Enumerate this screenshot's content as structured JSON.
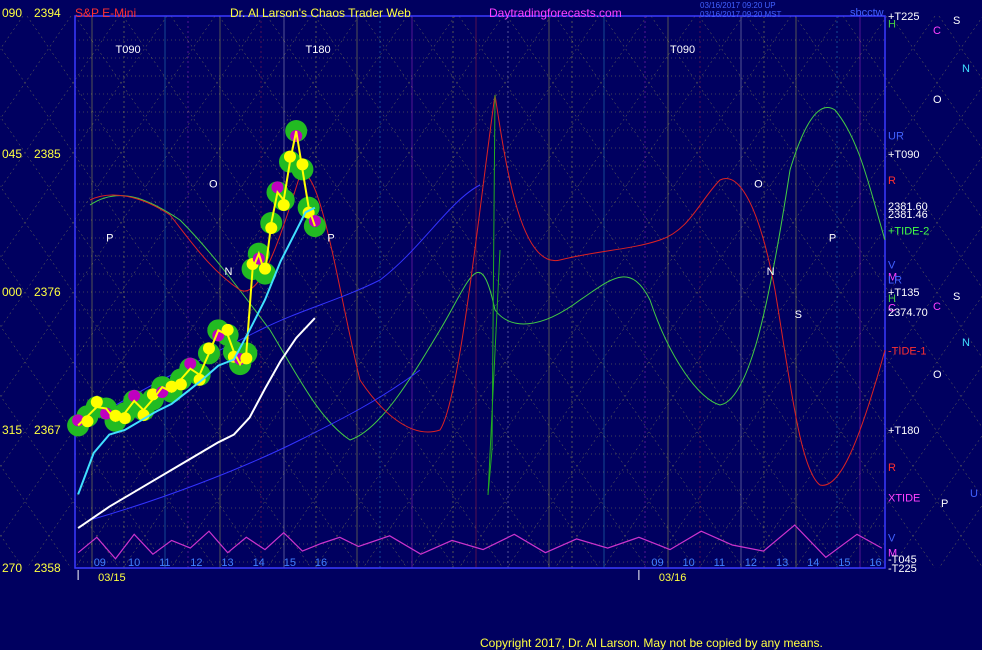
{
  "header": {
    "left_code": "090",
    "left_price": "2394",
    "instrument": "S&P E-Mini",
    "title": "Dr. Al Larson's Chaos Trader Web",
    "site": "Daytradingforecasts.com",
    "stamp1": "03/16/2017 09:20 UP",
    "stamp2": "03/16/2017 09:20 MST",
    "tag": "sbcctw",
    "right_top": "+T225"
  },
  "footer": {
    "copyright": "Copyright 2017, Dr. Al Larson. May not be copied by any means."
  },
  "colors": {
    "background": "#000060",
    "plot_border": "#3a3aff",
    "yellow": "#ffff40",
    "price": "#ffff00",
    "bubble_green": "#22bb22",
    "bubble_yellow": "#ffff00",
    "bubble_magenta": "#c000c0",
    "cyan": "#40e0ff",
    "white": "#ffffff",
    "magenta": "#cc33cc",
    "red": "#dd2222",
    "green": "#44cc44",
    "blue": "#3333ff"
  },
  "chart_data": {
    "type": "line",
    "title": "S&P E-Mini",
    "y_axis": {
      "range": [
        2358,
        2394
      ],
      "ticks": [
        {
          "code": "090",
          "price": 2394
        },
        {
          "code": "045",
          "price": 2385
        },
        {
          "code": "000",
          "price": 2376
        },
        {
          "code": "315",
          "price": 2367
        },
        {
          "code": "270",
          "price": 2358
        }
      ]
    },
    "x_axis": {
      "date_labels": [
        {
          "label": "03/15",
          "at": 9.0
        },
        {
          "label": "03/16",
          "at": 27.0
        }
      ],
      "hour_labels": [
        {
          "label": "09",
          "at": 9.5
        },
        {
          "label": "10",
          "at": 10.6
        },
        {
          "label": "11",
          "at": 11.6
        },
        {
          "label": "12",
          "at": 12.6
        },
        {
          "label": "13",
          "at": 13.6
        },
        {
          "label": "14",
          "at": 14.6
        },
        {
          "label": "15",
          "at": 15.6
        },
        {
          "label": "16",
          "at": 16.6
        },
        {
          "label": "09",
          "at": 27.4
        },
        {
          "label": "10",
          "at": 28.4
        },
        {
          "label": "11",
          "at": 29.4
        },
        {
          "label": "12",
          "at": 30.4
        },
        {
          "label": "13",
          "at": 31.4
        },
        {
          "label": "14",
          "at": 32.4
        },
        {
          "label": "15",
          "at": 33.4
        },
        {
          "label": "16",
          "at": 34.4
        }
      ],
      "range": [
        8.9,
        34.9
      ]
    },
    "right_labels": [
      {
        "text": "H",
        "price": 2393.5
      },
      {
        "text": "UR",
        "price": 2386.2
      },
      {
        "text": "+T090",
        "price": 2385.0
      },
      {
        "text": "R",
        "price": 2383.3
      },
      {
        "text": "2381.60",
        "price": 2381.6
      },
      {
        "text": "2381.46",
        "price": 2381.1
      },
      {
        "text": "+TIDE-2",
        "price": 2380.0
      },
      {
        "text": "V",
        "price": 2377.8
      },
      {
        "text": "M",
        "price": 2377.0
      },
      {
        "text": "LR",
        "price": 2376.8
      },
      {
        "text": "+T135",
        "price": 2376.0
      },
      {
        "text": "H",
        "price": 2375.6
      },
      {
        "text": "C",
        "price": 2375.0
      },
      {
        "text": "2374.70",
        "price": 2374.7
      },
      {
        "text": "-TIDE-1",
        "price": 2372.2
      },
      {
        "text": "+T180",
        "price": 2367.0
      },
      {
        "text": "R",
        "price": 2364.6
      },
      {
        "text": "XTIDE",
        "price": 2362.6
      },
      {
        "text": "V",
        "price": 2360.0
      },
      {
        "text": "M",
        "price": 2359.0
      },
      {
        "text": "-T045",
        "price": 2358.6
      },
      {
        "text": "-T225",
        "price": 2358.0
      }
    ],
    "far_right_letters": [
      "C",
      "S",
      "N",
      "O",
      "S",
      "C",
      "N",
      "O",
      "U",
      "P"
    ],
    "chart_labels": [
      {
        "text": "T090",
        "x": 10.2,
        "y": 2391.6
      },
      {
        "text": "T180",
        "x": 16.3,
        "y": 2391.6
      },
      {
        "text": "T090",
        "x": 28.0,
        "y": 2391.6
      },
      {
        "text": "O",
        "x": 13.2,
        "y": 2382.8
      },
      {
        "text": "O",
        "x": 30.7,
        "y": 2382.8
      },
      {
        "text": "P",
        "x": 9.9,
        "y": 2379.3
      },
      {
        "text": "P",
        "x": 17.0,
        "y": 2379.3
      },
      {
        "text": "P",
        "x": 33.1,
        "y": 2379.3
      },
      {
        "text": "N",
        "x": 13.7,
        "y": 2377.1
      },
      {
        "text": "N",
        "x": 31.1,
        "y": 2377.1
      },
      {
        "text": "S",
        "x": 32.0,
        "y": 2374.3
      }
    ],
    "series": [
      {
        "name": "Price",
        "color": "#ffff00",
        "x": [
          9.0,
          9.3,
          9.6,
          9.9,
          10.2,
          10.5,
          10.8,
          11.1,
          11.4,
          11.7,
          12.0,
          12.3,
          12.6,
          12.9,
          13.2,
          13.5,
          13.8,
          14.0,
          14.2,
          14.4,
          14.6,
          14.8,
          15.0,
          15.2,
          15.4,
          15.6,
          15.8,
          16.0,
          16.2,
          16.4,
          16.6
        ],
        "values": [
          2367.3,
          2367.9,
          2368.5,
          2368.4,
          2367.6,
          2368.1,
          2368.9,
          2368.3,
          2369.0,
          2369.8,
          2369.5,
          2370.3,
          2371.0,
          2370.6,
          2372.0,
          2373.5,
          2373.2,
          2372.1,
          2371.3,
          2372.0,
          2377.5,
          2378.5,
          2377.2,
          2380.5,
          2382.5,
          2382.0,
          2384.5,
          2386.5,
          2384.0,
          2381.5,
          2380.3
        ]
      },
      {
        "name": "Cyan average",
        "color": "#40e0ff",
        "x": [
          9.0,
          9.5,
          10.0,
          10.5,
          11.0,
          11.5,
          12.0,
          12.5,
          13.0,
          13.5,
          14.0,
          14.5,
          15.0,
          15.5,
          16.0,
          16.3,
          16.6
        ],
        "values": [
          2362.8,
          2365.5,
          2366.7,
          2367.0,
          2367.6,
          2368.2,
          2368.7,
          2369.5,
          2370.3,
          2371.2,
          2371.6,
          2373.5,
          2375.5,
          2378.0,
          2380.0,
          2381.2,
          2381.5
        ]
      },
      {
        "name": "White average",
        "color": "#ffffff",
        "x": [
          9.0,
          10.0,
          11.0,
          12.0,
          13.0,
          13.5,
          14.0,
          14.5,
          15.0,
          15.5,
          16.0,
          16.6
        ],
        "values": [
          2360.6,
          2362.0,
          2363.2,
          2364.4,
          2365.6,
          2366.2,
          2366.7,
          2367.8,
          2369.7,
          2371.5,
          2373.0,
          2374.3
        ]
      },
      {
        "name": "Magenta oscillator",
        "color": "#cc33cc",
        "x": [
          9.0,
          9.6,
          10.2,
          10.8,
          11.4,
          12.0,
          12.6,
          13.2,
          13.8,
          14.4,
          15.0,
          15.6,
          16.2,
          16.8,
          17.4,
          18.0,
          19.0,
          20.0,
          21.0,
          22.0,
          23.0,
          24.0,
          25.0,
          26.0,
          27.0,
          28.0,
          29.0,
          30.0,
          31.0,
          32.0,
          33.0,
          34.0,
          34.8
        ],
        "values": [
          2359.0,
          2360.0,
          2358.6,
          2360.2,
          2358.9,
          2359.8,
          2359.3,
          2360.4,
          2359.0,
          2360.0,
          2359.2,
          2360.3,
          2359.1,
          2359.6,
          2360.0,
          2359.4,
          2360.1,
          2358.9,
          2359.8,
          2359.2,
          2360.2,
          2359.0,
          2359.9,
          2359.3,
          2360.0,
          2359.2,
          2360.4,
          2359.5,
          2359.1,
          2360.8,
          2358.7,
          2360.2,
          2359.3
        ]
      }
    ]
  }
}
